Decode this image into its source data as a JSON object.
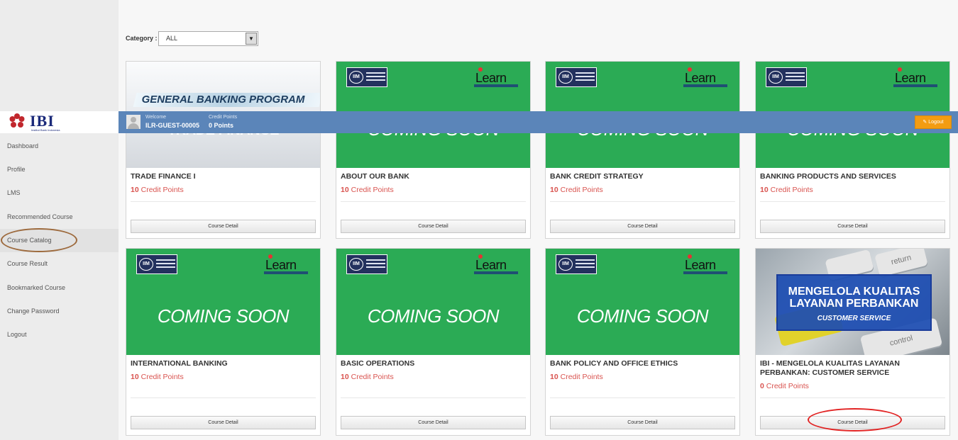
{
  "sidebar": {
    "logo": {
      "brand": "IBI",
      "tagline": "Institut Bank Indonesia"
    },
    "items": [
      {
        "label": "Dashboard"
      },
      {
        "label": "Profile"
      },
      {
        "label": "LMS"
      },
      {
        "label": "Recommended Course"
      },
      {
        "label": "Course Catalog"
      },
      {
        "label": "Course Result"
      },
      {
        "label": "Bookmarked Course"
      },
      {
        "label": "Change Password"
      },
      {
        "label": "Logout"
      }
    ],
    "active_item": "Course Catalog"
  },
  "topbar": {
    "welcome_label": "Welcome",
    "user_id": "ILR-GUEST-00005",
    "credit_label": "Credit Points",
    "credit_value": "0 Points",
    "logout_label": "Logout"
  },
  "filter": {
    "category_label": "Category :",
    "category_value": "ALL"
  },
  "courses": [
    {
      "title": "TRADE FINANCE I",
      "points": "10",
      "points_label": "Credit Points",
      "button": "Course Detail",
      "banner": "GENERAL BANKING PROGRAM",
      "banner_sub": "TRADE FINANCE"
    },
    {
      "title": "ABOUT OUR BANK",
      "points": "10",
      "points_label": "Credit Points",
      "button": "Course Detail",
      "banner": "COMING SOON"
    },
    {
      "title": "BANK CREDIT STRATEGY",
      "points": "10",
      "points_label": "Credit Points",
      "button": "Course Detail",
      "banner": "COMING SOON"
    },
    {
      "title": "BANKING PRODUCTS AND SERVICES",
      "points": "10",
      "points_label": "Credit Points",
      "button": "Course Detail",
      "banner": "COMING SOON"
    },
    {
      "title": "INTERNATIONAL BANKING",
      "points": "10",
      "points_label": "Credit Points",
      "button": "Course Detail",
      "banner": "COMING SOON"
    },
    {
      "title": "BASIC OPERATIONS",
      "points": "10",
      "points_label": "Credit Points",
      "button": "Course Detail",
      "banner": "COMING SOON"
    },
    {
      "title": "BANK POLICY AND OFFICE ETHICS",
      "points": "10",
      "points_label": "Credit Points",
      "button": "Course Detail",
      "banner": "COMING SOON"
    },
    {
      "title": "IBI - MENGELOLA KUALITAS LAYANAN PERBANKAN: CUSTOMER SERVICE",
      "points": "0",
      "points_label": "Credit Points",
      "button": "Course Detail",
      "banner": "MENGELOLA KUALITAS LAYANAN PERBANKAN",
      "banner_sub": "CUSTOMER SERVICE",
      "key_labels": [
        "return",
        "control"
      ]
    }
  ],
  "badges": {
    "iim": "IIM",
    "ilearn": "Learn"
  },
  "colors": {
    "topbar": "#5b85b9",
    "card_green": "#2bab55",
    "points_red": "#d9534f",
    "logout_orange": "#f39c12"
  }
}
